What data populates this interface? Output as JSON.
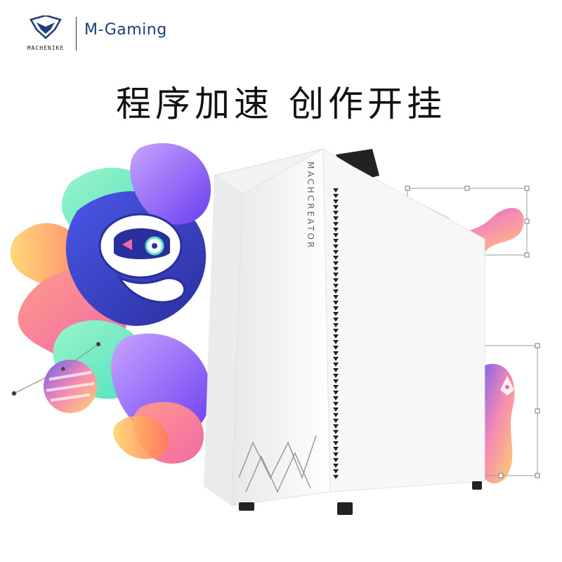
{
  "brand": {
    "logo_text": "MACHENIKE",
    "name": "M-Gaming"
  },
  "headline": "程序加速  创作开挂",
  "product": {
    "side_label": "MACHCREATOR"
  },
  "colors": {
    "brand_blue": "#1e3d7a",
    "case_white": "#f5f5f5",
    "splash_pink": "#f06aa6",
    "splash_purple": "#8b5cf6",
    "splash_teal": "#4ee0c0"
  },
  "icons": [
    "crop-icon",
    "pen-icon",
    "logo-mark-icon"
  ]
}
